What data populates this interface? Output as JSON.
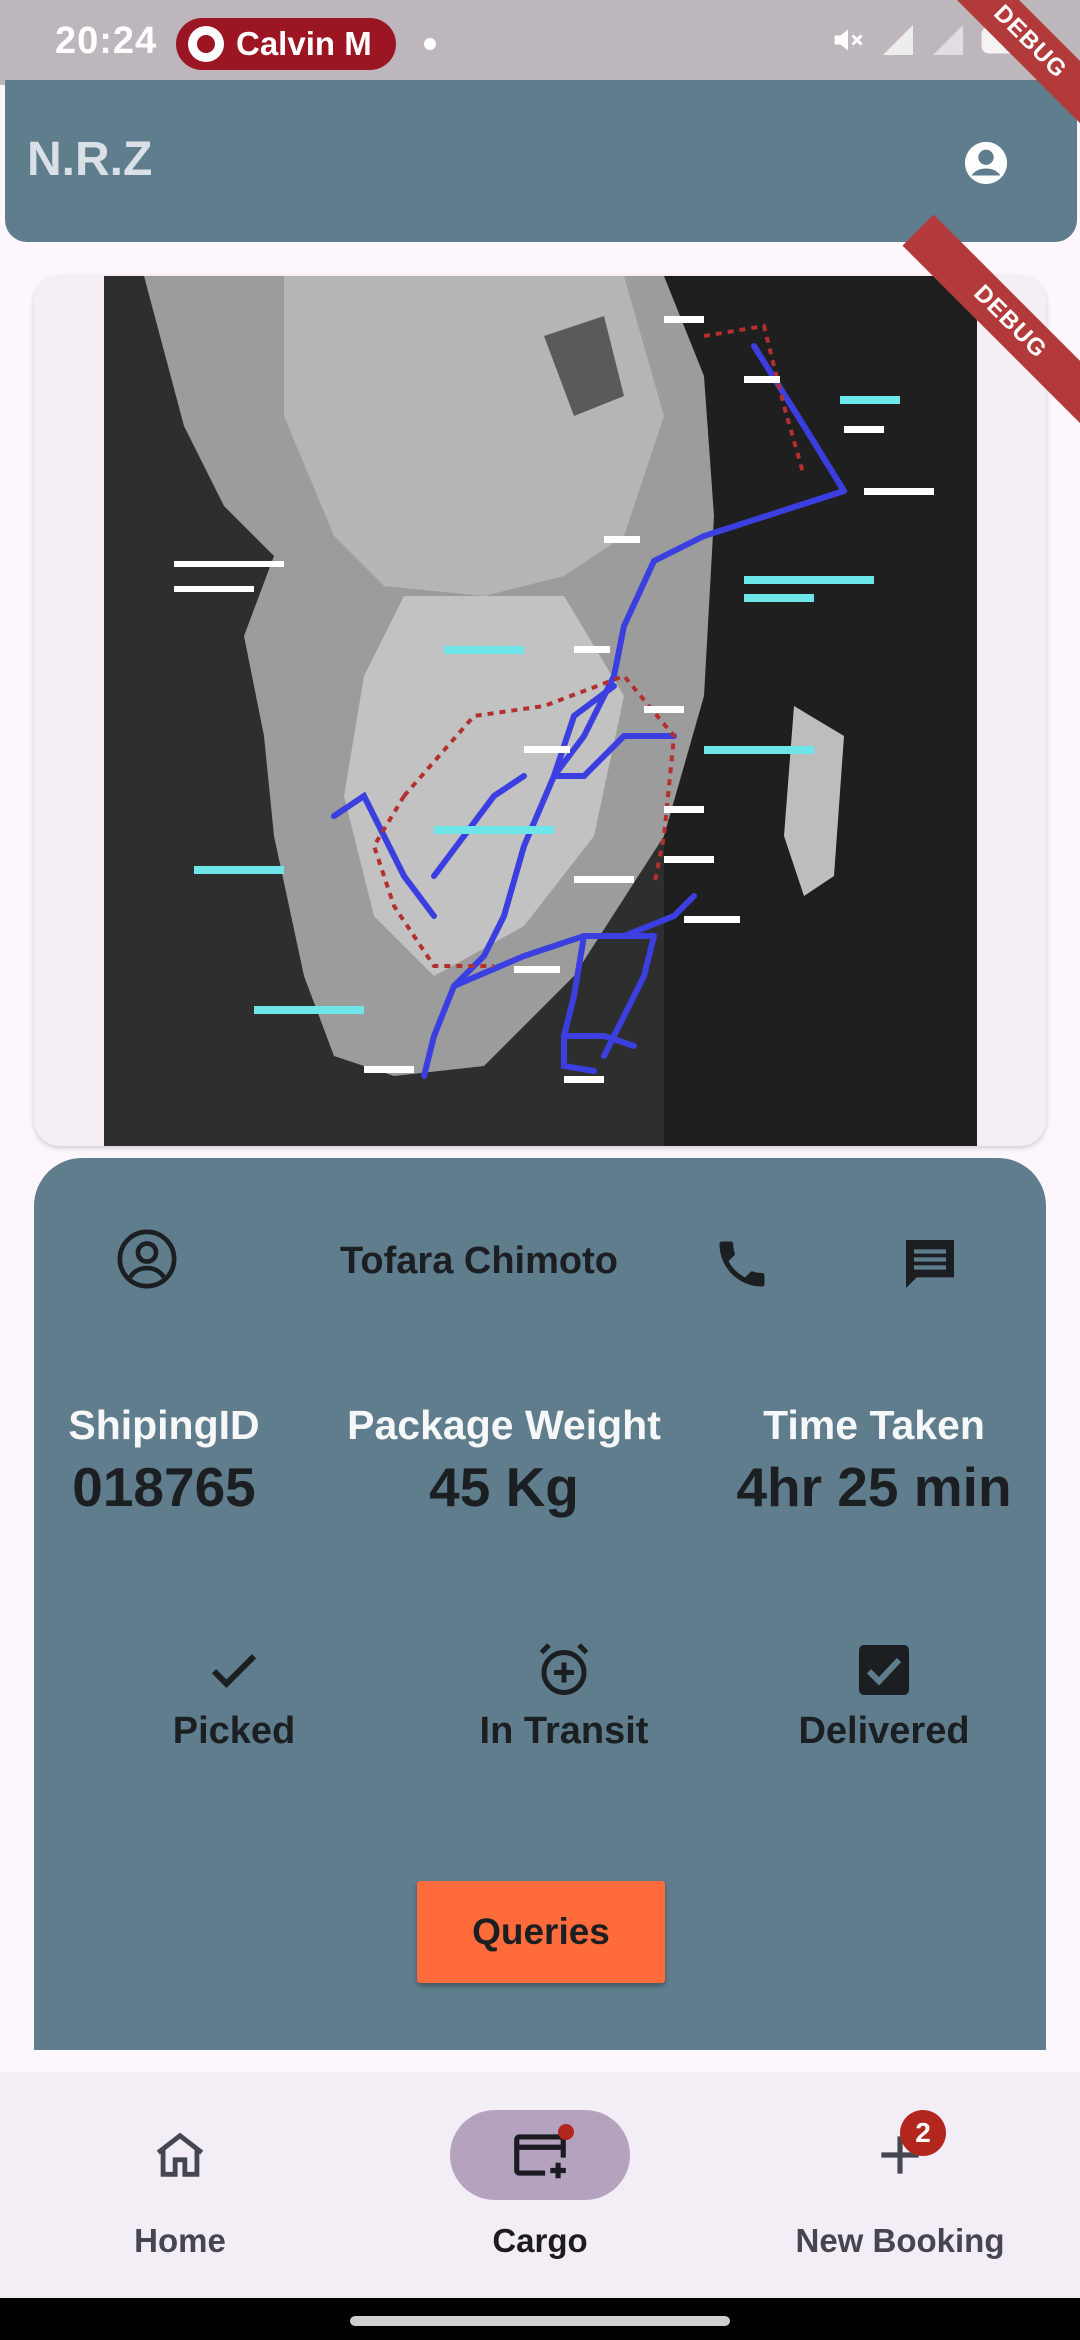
{
  "status_bar": {
    "time": "20:24",
    "notification_chip": "Calvin M"
  },
  "debug_banner": "DEBUG",
  "app_bar": {
    "title": "N.R.Z"
  },
  "map": {
    "description_icon": "railway-route-map"
  },
  "driver": {
    "name": "Tofara Chimoto"
  },
  "stats": [
    {
      "label": "ShipingID",
      "value": "018765"
    },
    {
      "label": "Package Weight",
      "value": "45 Kg"
    },
    {
      "label": "Time Taken",
      "value": "4hr 25 min"
    }
  ],
  "stages": [
    {
      "label": "Picked",
      "icon": "check-icon"
    },
    {
      "label": "In Transit",
      "icon": "alarm-add-icon"
    },
    {
      "label": "Delivered",
      "icon": "checkbox-checked-icon"
    }
  ],
  "actions": {
    "queries_label": "Queries"
  },
  "bottom_nav": {
    "items": [
      {
        "label": "Home",
        "icon": "home-icon",
        "active": false
      },
      {
        "label": "Cargo",
        "icon": "card-add-icon",
        "active": true
      },
      {
        "label": "New Booking",
        "icon": "plus-icon",
        "active": false,
        "badge": "2"
      }
    ]
  },
  "colors": {
    "app_bar": "#5f7d8c",
    "panel": "#5f7d8c",
    "queries_button": "#ff6b3a",
    "nav_active_pill": "#b4a2bf",
    "badge": "#b3261e"
  }
}
